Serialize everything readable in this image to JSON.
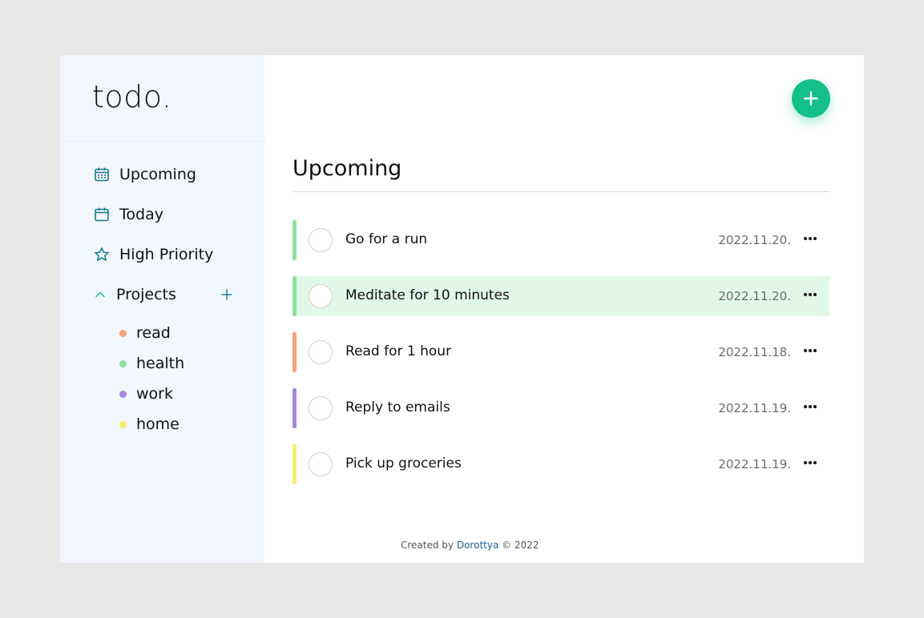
{
  "app": {
    "logo": "todo."
  },
  "sidebar": {
    "items": [
      {
        "label": "Upcoming",
        "icon": "calendar-grid-icon"
      },
      {
        "label": "Today",
        "icon": "calendar-icon"
      },
      {
        "label": "High Priority",
        "icon": "star-icon"
      }
    ],
    "projects_label": "Projects",
    "projects": [
      {
        "label": "read",
        "color": "#f7a07a"
      },
      {
        "label": "health",
        "color": "#8fe0a0"
      },
      {
        "label": "work",
        "color": "#a886dd"
      },
      {
        "label": "home",
        "color": "#f4ee74"
      }
    ]
  },
  "main": {
    "title": "Upcoming",
    "tasks": [
      {
        "title": "Go for a run",
        "date": "2022.11.20.",
        "color": "#8fe0a0",
        "highlighted": false
      },
      {
        "title": "Meditate for 10 minutes",
        "date": "2022.11.20.",
        "color": "#8fe0a0",
        "highlighted": true
      },
      {
        "title": "Read for 1 hour",
        "date": "2022.11.18.",
        "color": "#f7a07a",
        "highlighted": false
      },
      {
        "title": "Reply to emails",
        "date": "2022.11.19.",
        "color": "#a886dd",
        "highlighted": false
      },
      {
        "title": "Pick up groceries",
        "date": "2022.11.19.",
        "color": "#f4ee74",
        "highlighted": false
      }
    ]
  },
  "footer": {
    "prefix": "Created by ",
    "author": "Dorottya",
    "suffix": " © 2022"
  },
  "colors": {
    "accent": "#13c08a",
    "icon": "#1a7a8a"
  }
}
